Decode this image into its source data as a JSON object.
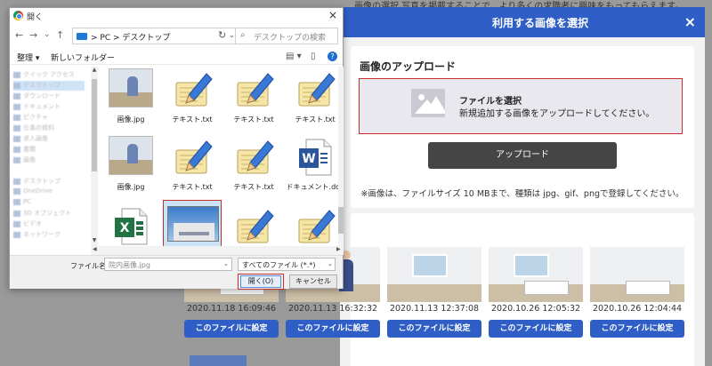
{
  "background": {
    "top_text": "画像の選択 写真を掲載することで、より多くの求職者に興味をもってもらえます。"
  },
  "modal": {
    "title": "利用する画像を選択",
    "close_label": "×",
    "upload_heading": "画像のアップロード",
    "dropzone_title": "ファイルを選択",
    "dropzone_desc": "新規追加する画像をアップロードしてください。",
    "upload_button": "アップロード",
    "upload_note": "※画像は、ファイルサイズ 10 MBまで、種類は jpg、gif、pngで登録してください。",
    "gallery": [
      {
        "date": "2020.11.18 16:09:46",
        "button": "このファイルに設定"
      },
      {
        "date": "2020.11.13 16:32:32",
        "button": "このファイルに設定"
      },
      {
        "date": "2020.11.13 12:37:08",
        "button": "このファイルに設定"
      },
      {
        "date": "2020.10.26 12:05:32",
        "button": "このファイルに設定"
      },
      {
        "date": "2020.10.26 12:04:44",
        "button": "このファイルに設定"
      }
    ]
  },
  "dialog": {
    "title": "開く",
    "close_label": "×",
    "nav_back": "←",
    "nav_forward": "→",
    "nav_recent": "⌄",
    "nav_up": "↑",
    "address_path": "> PC > デスクトップ",
    "address_drop": "⌄",
    "refresh": "↻",
    "search_placeholder": "デスクトップの検索",
    "toolbar_organize": "整理 ▾",
    "toolbar_new_folder": "新しいフォルダー",
    "view_icon": "▤ ▾",
    "pane_icon": "▯",
    "help_label": "?",
    "nav_pane_items": [
      "クイック アクセス",
      "デスクトップ",
      "ダウンロード",
      "ドキュメント",
      "ピクチャ",
      "仕事の資料",
      "求人画像",
      "書類",
      "画像",
      "",
      "デスクトップ",
      "OneDrive",
      "PC",
      "3D オブジェクト",
      "ビデオ",
      "ネットワーク"
    ],
    "files": [
      {
        "name": "画像.jpg",
        "type": "photo"
      },
      {
        "name": "テキスト.txt",
        "type": "text"
      },
      {
        "name": "テキスト.txt",
        "type": "text"
      },
      {
        "name": "テキスト.txt",
        "type": "text"
      },
      {
        "name": "画像.jpg",
        "type": "photo"
      },
      {
        "name": "テキスト.txt",
        "type": "text"
      },
      {
        "name": "テキスト.txt",
        "type": "text"
      },
      {
        "name": "ドキュメント.doc",
        "type": "word"
      },
      {
        "name": "エクセル.xlsx",
        "type": "excel"
      },
      {
        "name": "院内画像.jpg",
        "type": "building",
        "selected": true
      },
      {
        "name": "テキスト.txt",
        "type": "text"
      },
      {
        "name": "テキスト.txt",
        "type": "text"
      }
    ],
    "filename_label": "ファイル名(N):",
    "filename_value": "院内画像.jpg",
    "filetype_value": "すべてのファイル (*.*)",
    "open_button": "開く(O)",
    "cancel_button": "キャンセル"
  }
}
